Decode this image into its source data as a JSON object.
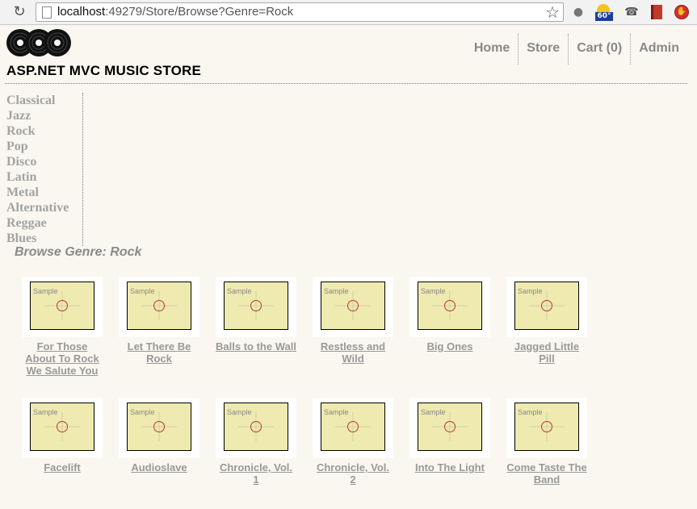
{
  "browser": {
    "url_host": "localhost",
    "url_rest": ":49279/Store/Browse?Genre=Rock",
    "weather_temp": "60°"
  },
  "site": {
    "title": "ASP.NET MVC MUSIC STORE",
    "nav": [
      {
        "label": "Home"
      },
      {
        "label": "Store"
      },
      {
        "label": "Cart (0)"
      },
      {
        "label": "Admin"
      }
    ]
  },
  "genres": [
    "Classical",
    "Jazz",
    "Rock",
    "Pop",
    "Disco",
    "Latin",
    "Metal",
    "Alternative",
    "Reggae",
    "Blues"
  ],
  "browse": {
    "title": "Browse Genre: Rock",
    "placeholder_label": "Sample",
    "albums": [
      {
        "title": "For Those About To Rock We Salute You"
      },
      {
        "title": "Let There Be Rock"
      },
      {
        "title": "Balls to the Wall"
      },
      {
        "title": "Restless and Wild"
      },
      {
        "title": "Big Ones"
      },
      {
        "title": "Jagged Little Pill"
      },
      {
        "title": "Facelift"
      },
      {
        "title": "Audioslave"
      },
      {
        "title": "Chronicle, Vol. 1"
      },
      {
        "title": "Chronicle, Vol. 2"
      },
      {
        "title": "Into The Light"
      },
      {
        "title": "Come Taste The Band"
      }
    ]
  },
  "colors": {
    "page_bg": "#f9f7ef",
    "placeholder_fill": "#eeeab0",
    "link_gray": "#999999"
  }
}
